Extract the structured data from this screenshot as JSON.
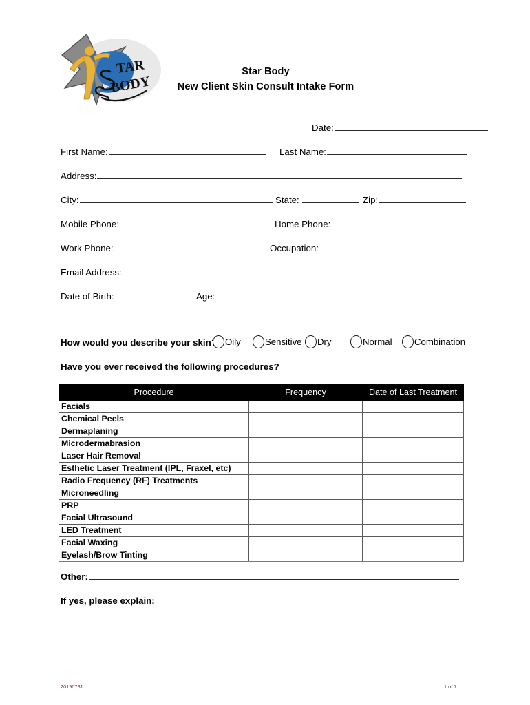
{
  "document": {
    "title_line1": "Star Body",
    "title_line2": "New Client Skin Consult Intake Form",
    "logo_alt": "Star Body logo"
  },
  "fields": {
    "date_label": "Date:",
    "first_name_label": "First Name:",
    "last_name_label": "Last Name:",
    "address_label": "Address:",
    "city_label": "City:",
    "state_label": "State:",
    "zip_label": "Zip:",
    "mobile_phone_label": "Mobile Phone:",
    "home_phone_label": "Home Phone:",
    "work_phone_label": "Work Phone:",
    "occupation_label": "Occupation:",
    "email_label": "Email Address:",
    "dob_label": "Date of Birth:",
    "age_label": "Age:"
  },
  "skin": {
    "question": "How would you describe your skin?",
    "options": [
      "Oily",
      "Sensitive",
      "Dry",
      "Normal",
      "Combination"
    ]
  },
  "procedures": {
    "question": "Have you ever received the following procedures?",
    "columns": [
      "Procedure",
      "Frequency",
      "Date of Last Treatment"
    ],
    "rows": [
      "Facials",
      "Chemical Peels",
      "Dermaplaning",
      "Microdermabrasion",
      "Laser Hair Removal",
      "Esthetic Laser Treatment (IPL, Fraxel, etc)",
      "Radio Frequency (RF) Treatments",
      "Microneedling",
      "PRP",
      "Facial Ultrasound",
      "LED Treatment",
      "Facial Waxing",
      "Eyelash/Brow Tinting"
    ]
  },
  "bottom": {
    "other_label": "Other:",
    "explain_label": "If yes, please explain:"
  },
  "footer": {
    "revision": "20190731",
    "page": "1 of 7"
  },
  "colors": {
    "header_bg": "#000000",
    "header_text": "#ffffff",
    "rule": "#2b2b2b",
    "footer_revision": "#7b2f2f",
    "logo_star": "#808080",
    "logo_disc": "#2a6fb5",
    "logo_figure": "#e8b33c"
  }
}
